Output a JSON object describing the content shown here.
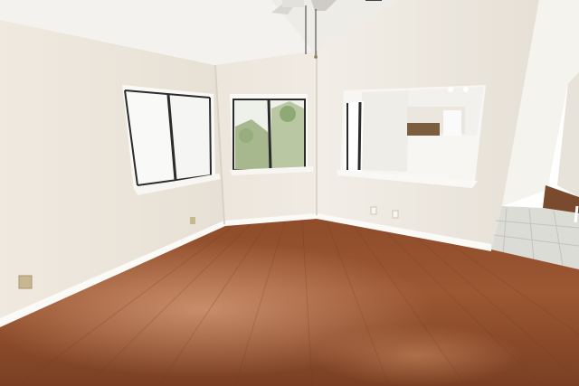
{
  "scene": {
    "subject": "empty-room-interior",
    "colors": {
      "wall_light": "#f1ede6",
      "wall_mid": "#e9e3da",
      "wall_shadow": "#ddd6cb",
      "ceiling": "#f4f3f0",
      "floor_dark": "#7a3f22",
      "floor_mid": "#9a5532",
      "floor_light": "#b86f48",
      "baseboard": "#fbfaf7",
      "window_frame": "#2b2b2b",
      "window_sky": "#f6f7f5",
      "foliage": "#9fb486",
      "tile": "#dcdcd7",
      "outlet": "#c8b790"
    }
  }
}
